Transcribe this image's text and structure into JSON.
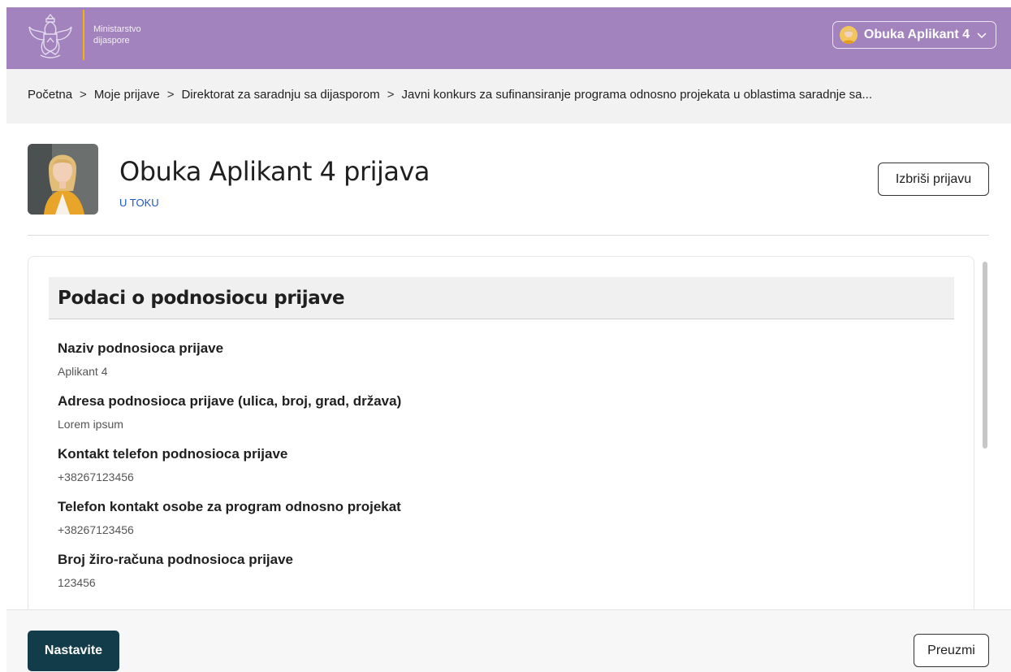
{
  "header": {
    "brand_line1": "Ministarstvo",
    "brand_line2": "dijaspore",
    "user_name": "Obuka Aplikant 4",
    "crest_icon": "coat-of-arms-icon"
  },
  "breadcrumb": {
    "items": [
      "Početna",
      "Moje prijave",
      "Direktorat za saradnju sa dijasporom",
      "Javni konkurs za sufinansiranje programa odnosno projekata u oblastima saradnje sa..."
    ],
    "separator": ">"
  },
  "application": {
    "title": "Obuka Aplikant 4 prijava",
    "status": "U TOKU",
    "delete_label": "Izbriši prijavu"
  },
  "section": {
    "title": "Podaci o podnosiocu prijave",
    "fields": [
      {
        "label": "Naziv podnosioca prijave",
        "value": "Aplikant 4"
      },
      {
        "label": "Adresa podnosioca prijave (ulica, broj, grad, država)",
        "value": "Lorem ipsum"
      },
      {
        "label": "Kontakt telefon podnosioca prijave",
        "value": "+38267123456"
      },
      {
        "label": "Telefon kontakt osobe za program odnosno projekat",
        "value": "+38267123456"
      },
      {
        "label": "Broj žiro-računa podnosioca prijave",
        "value": "123456"
      }
    ]
  },
  "footer": {
    "continue_label": "Nastavite",
    "download_label": "Preuzmi"
  },
  "colors": {
    "topbar": "#a283bd",
    "accent_divider": "#f4b400",
    "status": "#1a56c8",
    "primary_button": "#133c4a"
  }
}
